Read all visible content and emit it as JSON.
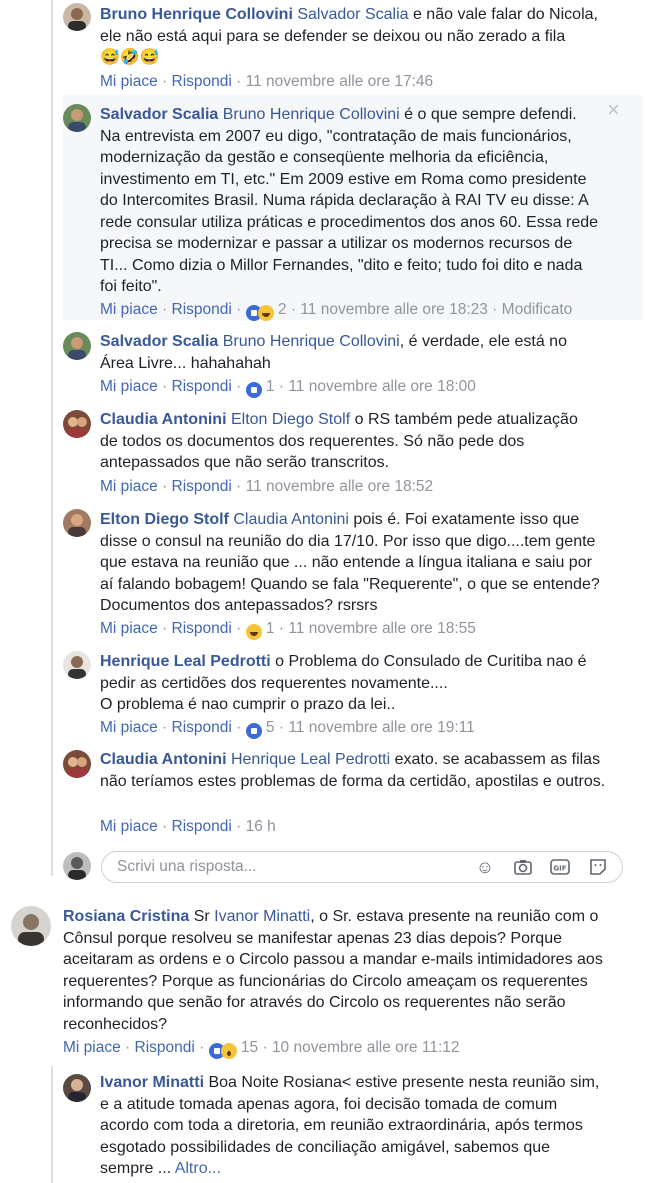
{
  "comments": [
    {
      "name": "Bruno Henrique Collovini",
      "tag": "Salvador Scalia",
      "text": " e não vale falar do Nicola, ele não está aqui para se defender se deixou ou não zerado a fila",
      "emojis": "😅🤣😅",
      "like": "Mi piace",
      "reply": "Rispondi",
      "time": "11 novembre alle ore 17:46"
    },
    {
      "name": "Salvador Scalia",
      "tag": "Bruno Henrique Collovini",
      "text": " é o que sempre defendi. Na entrevista em 2007 eu digo, \"contratação de mais funcionários, modernização da gestão e conseqüente melhoria da eficiência, investimento em TI, etc.\" Em 2009 estive em Roma como presidente do Intercomites Brasil. Numa rápida declaração à RAI TV eu disse: A rede consular utiliza práticas e procedimentos dos anos 60. Essa rede precisa se modernizar e passar a utilizar os modernos recursos de TI... Como dizia o Millor Fernandes, \"dito e feito; tudo foi dito e nada foi feito\".",
      "like": "Mi piace",
      "reply": "Rispondi",
      "count": "2",
      "time": "11 novembre alle ore 18:23",
      "edited": "Modificato"
    },
    {
      "name": "Salvador Scalia",
      "tag": "Bruno Henrique Collovini",
      "text": ", é verdade, ele está no Área Livre... hahahahah",
      "like": "Mi piace",
      "reply": "Rispondi",
      "count": "1",
      "time": "11 novembre alle ore 18:00"
    },
    {
      "name": "Claudia Antonini",
      "tag": "Elton Diego Stolf",
      "text": " o RS também pede atualização de todos os documentos dos requerentes. Só não pede dos antepassados que não serão transcritos.",
      "like": "Mi piace",
      "reply": "Rispondi",
      "time": "11 novembre alle ore 18:52"
    },
    {
      "name": "Elton Diego Stolf",
      "tag": "Claudia Antonini",
      "text": " pois é. Foi exatamente isso que disse o consul na reunião do dia 17/10. Por isso que digo....tem gente que estava na reunião que ... não entende a língua italiana e saiu por aí falando bobagem! Quando se fala \"Requerente\", o que se entende? Documentos dos antepassados? rsrsrs",
      "like": "Mi piace",
      "reply": "Rispondi",
      "count": "1",
      "time": "11 novembre alle ore 18:55"
    },
    {
      "name": "Henrique Leal Pedrotti",
      "text": " o Problema do Consulado de Curitiba nao é pedir as certidões dos requerentes novamente....",
      "text2": "O problema é nao cumprir o prazo da lei..",
      "like": "Mi piace",
      "reply": "Rispondi",
      "count": "5",
      "time": "11 novembre alle ore 19:11"
    },
    {
      "name": "Claudia Antonini",
      "tag": "Henrique Leal Pedrotti",
      "text": " exato. se acabassem as filas não teríamos estes problemas de forma da certidão, apostilas e outros.",
      "like": "Mi piace",
      "reply": "Rispondi",
      "time": "16 h"
    }
  ],
  "reply_box": {
    "placeholder": "Scrivi una risposta..."
  },
  "top_comment": {
    "name": "Rosiana Cristina",
    "prefix": " Sr ",
    "tag": "Ivanor Minatti",
    "text": ", o Sr. estava presente na reunião com o Cônsul porque resolveu se manifestar apenas 23 dias depois? Porque aceitaram as ordens e o Circolo passou a mandar e-mails intimidadores aos requerentes? Porque as funcionárias do Circolo ameaçam os requerentes informando que senão for através do Circolo os requerentes não serão reconhecidos?",
    "like": "Mi piace",
    "reply": "Rispondi",
    "count": "15",
    "time": "10 novembre alle ore 11:12"
  },
  "last_reply": {
    "name": "Ivanor Minatti",
    "text": " Boa Noite Rosiana< estive presente nesta reunião sim, e a atitude tomada apenas agora, foi decisão tomada de comum acordo com toda a diretoria, em reunião extraordinária, após termos esgotado possibilidades de conciliação amigável, sabemos que sempre ... ",
    "more": "Altro..."
  },
  "sep": " · "
}
